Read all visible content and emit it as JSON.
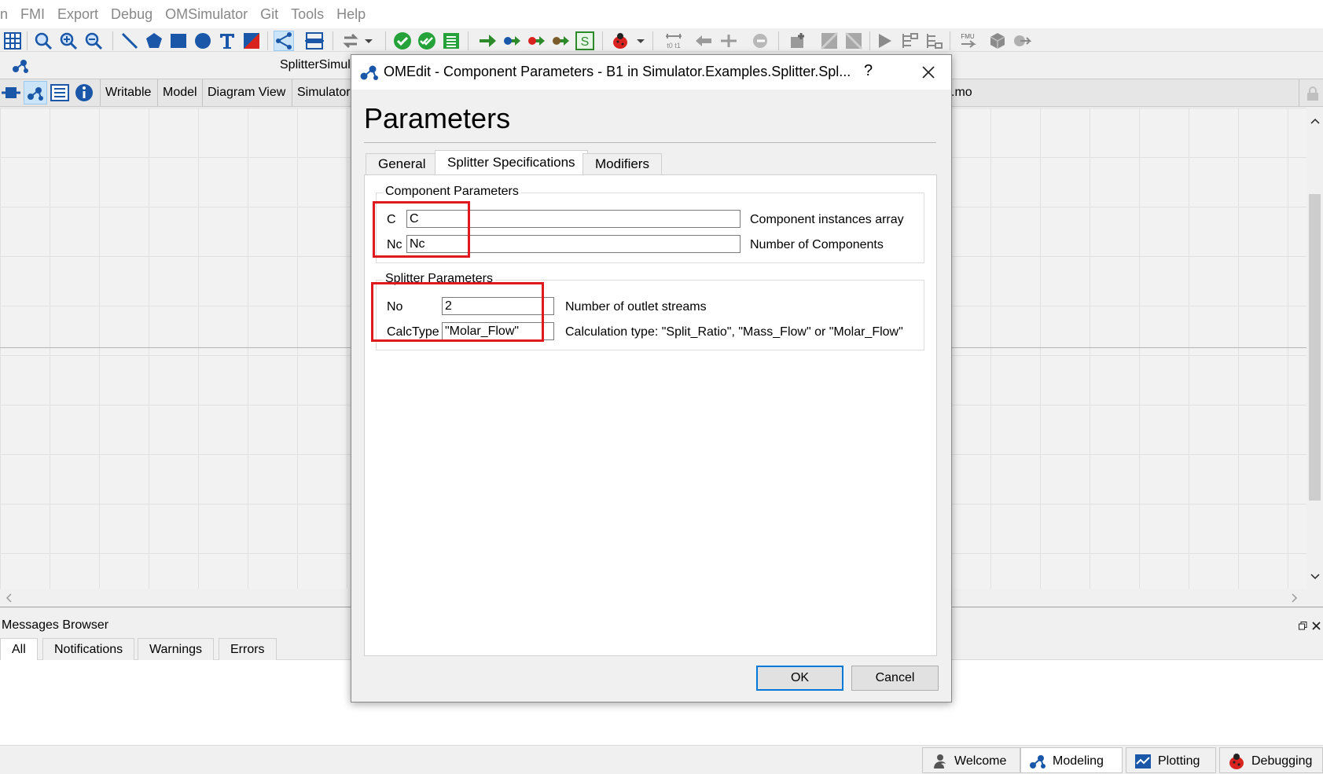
{
  "menubar": {
    "items": [
      "n",
      "FMI",
      "Export",
      "Debug",
      "OMSimulator",
      "Git",
      "Tools",
      "Help"
    ]
  },
  "model_widget": {
    "title": "SplitterSimul",
    "tab_suffix": ".mo",
    "row_labels": [
      "Writable",
      "Model",
      "Diagram View",
      "Simulator"
    ]
  },
  "messages_browser": {
    "title": "Messages Browser",
    "tabs": [
      "All",
      "Notifications",
      "Warnings",
      "Errors"
    ],
    "active_tab": "All"
  },
  "perspectives": {
    "items": [
      "Welcome",
      "Modeling",
      "Plotting",
      "Debugging"
    ],
    "active": "Modeling"
  },
  "dialog": {
    "title": "OMEdit - Component Parameters - B1 in Simulator.Examples.Splitter.Spl...",
    "help": "?",
    "heading": "Parameters",
    "tabs": [
      "General",
      "Splitter Specifications",
      "Modifiers"
    ],
    "active_tab": "Splitter Specifications",
    "component_group": {
      "title": "Component Parameters",
      "params": [
        {
          "label": "C",
          "value": "C",
          "description": "Component instances array"
        },
        {
          "label": "Nc",
          "value": "Nc",
          "description": "Number of Components"
        }
      ]
    },
    "splitter_group": {
      "title": "Splitter Parameters",
      "params": [
        {
          "label": "No",
          "value": "2",
          "description": "Number of outlet streams"
        },
        {
          "label": "CalcType",
          "value": "\"Molar_Flow\"",
          "description": "Calculation type: \"Split_Ratio\", \"Mass_Flow\" or \"Molar_Flow\""
        }
      ]
    },
    "ok_label": "OK",
    "cancel_label": "Cancel"
  },
  "highlight_color": "#e0191e",
  "accent_color": "#0078d7"
}
